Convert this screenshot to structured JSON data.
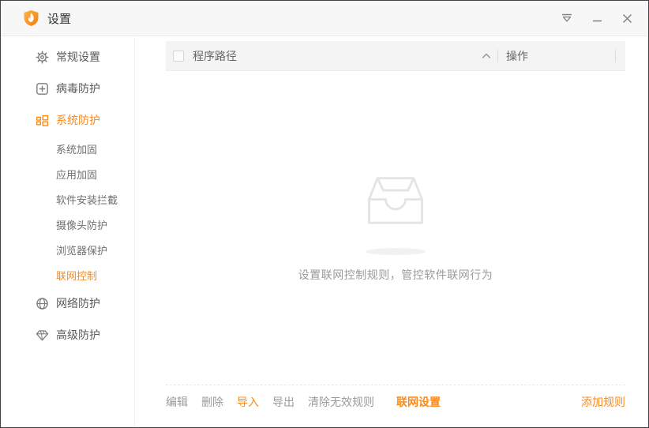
{
  "window": {
    "title": "设置"
  },
  "titlebar": {
    "controls": [
      {
        "name": "main-menu"
      },
      {
        "name": "minimize"
      },
      {
        "name": "close"
      }
    ]
  },
  "sidebar": {
    "items": [
      {
        "label": "常规设置",
        "icon": "gear",
        "active": false
      },
      {
        "label": "病毒防护",
        "icon": "plus-square",
        "active": false
      },
      {
        "label": "系统防护",
        "icon": "layout-grid",
        "active": true
      },
      {
        "label": "网络防护",
        "icon": "globe",
        "active": false
      },
      {
        "label": "高级防护",
        "icon": "diamond",
        "active": false
      }
    ],
    "sub_items": [
      {
        "label": "系统加固",
        "active": false
      },
      {
        "label": "应用加固",
        "active": false
      },
      {
        "label": "软件安装拦截",
        "active": false
      },
      {
        "label": "摄像头防护",
        "active": false
      },
      {
        "label": "浏览器保护",
        "active": false
      },
      {
        "label": "联网控制",
        "active": true
      }
    ]
  },
  "table": {
    "header": {
      "path_column": "程序路径",
      "action_column": "操作",
      "collapse_icon": "chevron-up",
      "select_all_checked": false
    }
  },
  "empty_state": {
    "icon": "empty-inbox",
    "message": "设置联网控制规则，管控软件联网行为"
  },
  "toolbar": {
    "edit": "编辑",
    "delete": "删除",
    "import": "导入",
    "export": "导出",
    "clear_invalid": "清除无效规则",
    "network_settings": "联网设置",
    "add_rule": "添加规则"
  },
  "colors": {
    "accent": "#f98b1d",
    "titlebar_bg": "#f7f7f7",
    "header_bg": "#f4f4f4",
    "muted_text": "#9b9b9b",
    "empty_icon": "#e4e4e4"
  }
}
